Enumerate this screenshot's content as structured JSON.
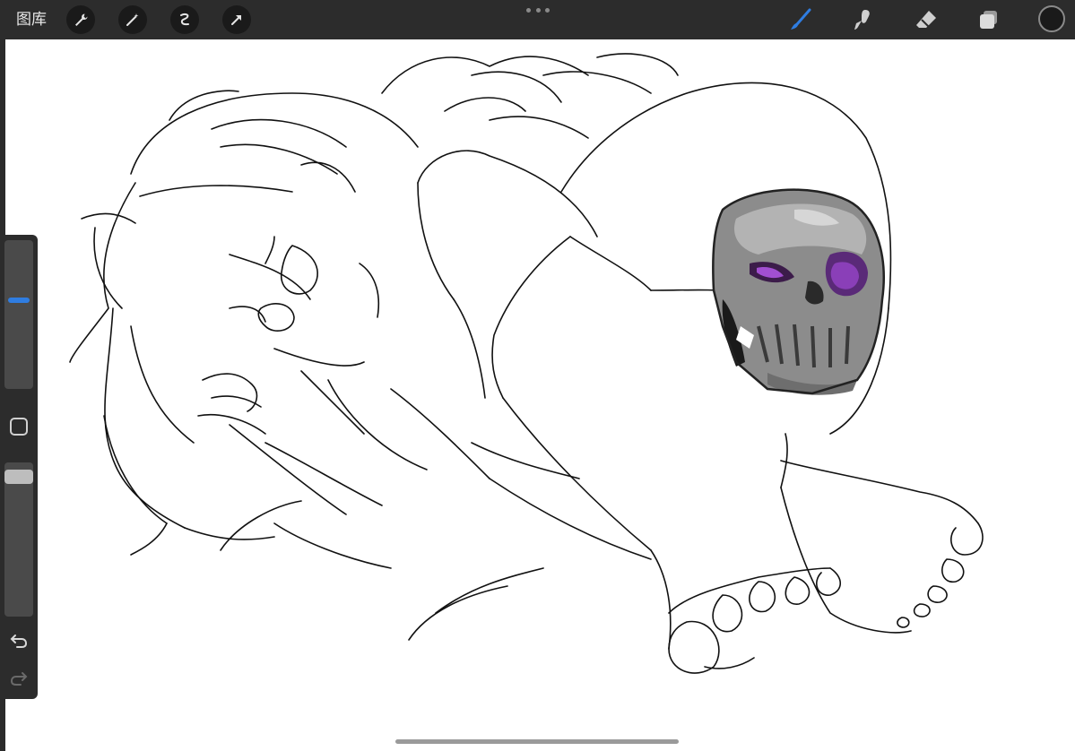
{
  "toolbar": {
    "gallery_label": "图库",
    "actions": [
      {
        "name": "actions-wrench-icon"
      },
      {
        "name": "adjustments-wand-icon"
      },
      {
        "name": "selection-icon"
      },
      {
        "name": "transform-arrow-icon"
      }
    ],
    "tools": [
      {
        "name": "brush-icon",
        "active": true
      },
      {
        "name": "smudge-icon",
        "active": false
      },
      {
        "name": "eraser-icon",
        "active": false
      },
      {
        "name": "layers-icon",
        "active": false
      }
    ],
    "current_color": "#1a1a1a"
  },
  "sidebar": {
    "brush_size_slider": {
      "level": 0.6
    },
    "opacity_slider": {
      "level": 0.95
    },
    "modify_button": "square-modify-icon",
    "undo": "undo-icon",
    "redo": "redo-icon"
  },
  "colors": {
    "accent": "#2f7de1",
    "toolbar_bg": "#2c2c2c",
    "canvas_bg": "#ffffff",
    "skull_gray": "#8c8c8c",
    "skull_purple": "#8a3fb8"
  }
}
